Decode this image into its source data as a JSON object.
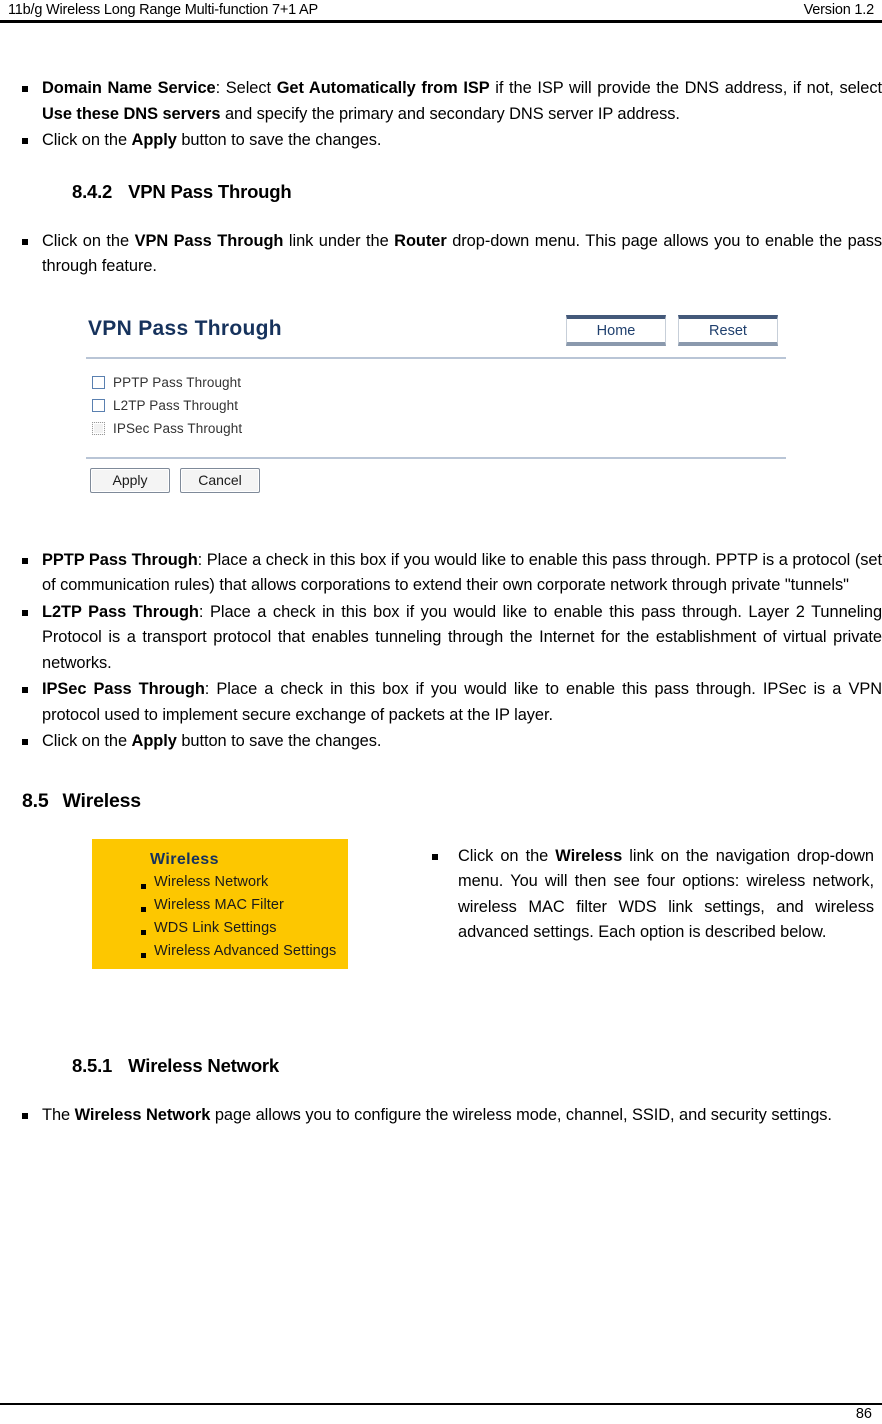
{
  "header": {
    "left": "11b/g Wireless Long Range Multi-function 7+1 AP",
    "right": "Version 1.2"
  },
  "footer": {
    "page_number": "86"
  },
  "intro_bullets": [
    {
      "parts": [
        {
          "text": "Domain Name Service",
          "bold": true
        },
        {
          "text": ": Select ",
          "bold": false
        },
        {
          "text": "Get Automatically from ISP",
          "bold": true
        },
        {
          "text": " if the ISP will provide the DNS address, if not, select ",
          "bold": false
        },
        {
          "text": "Use these DNS servers",
          "bold": true
        },
        {
          "text": " and specify the primary and secondary DNS server IP address.",
          "bold": false
        }
      ]
    },
    {
      "parts": [
        {
          "text": "Click on the ",
          "bold": false
        },
        {
          "text": "Apply",
          "bold": true
        },
        {
          "text": " button to save the changes.",
          "bold": false
        }
      ]
    }
  ],
  "section_842": {
    "number": "8.4.2",
    "title": "VPN Pass Through",
    "bullets": [
      {
        "parts": [
          {
            "text": "Click on the ",
            "bold": false
          },
          {
            "text": "VPN Pass Through",
            "bold": true
          },
          {
            "text": " link under the ",
            "bold": false
          },
          {
            "text": "Router",
            "bold": true
          },
          {
            "text": " drop-down menu. This page allows you to enable the pass through feature.",
            "bold": false
          }
        ]
      }
    ]
  },
  "figure_vpn": {
    "title": "VPN Pass Through",
    "nav_buttons": [
      {
        "label": "Home"
      },
      {
        "label": "Reset"
      }
    ],
    "checkboxes": [
      {
        "label": "PPTP Pass Throught",
        "checked": false,
        "disabled": false
      },
      {
        "label": "L2TP Pass Throught",
        "checked": false,
        "disabled": false
      },
      {
        "label": "IPSec Pass Throught",
        "checked": false,
        "disabled": true
      }
    ],
    "form_buttons": [
      {
        "label": "Apply"
      },
      {
        "label": "Cancel"
      }
    ],
    "accent_color": "#16325c",
    "rule_color": "#b9c5d6"
  },
  "vpn_bullets": [
    {
      "parts": [
        {
          "text": "PPTP Pass Through",
          "bold": true
        },
        {
          "text": ": Place a check in this box if you would like to enable this pass through. PPTP is a protocol (set of communication rules) that allows corporations to extend their own corporate network through private \"tunnels\"",
          "bold": false
        }
      ]
    },
    {
      "parts": [
        {
          "text": "L2TP Pass Through",
          "bold": true
        },
        {
          "text": ": Place a check in this box if you would like to enable this pass through. Layer 2 Tunneling Protocol is a transport protocol that enables tunneling through the Internet for the establishment of virtual private networks.",
          "bold": false
        }
      ]
    },
    {
      "parts": [
        {
          "text": "IPSec Pass Through",
          "bold": true
        },
        {
          "text": ": Place a check in this box if you would like to enable this pass through. IPSec is a VPN protocol used to implement secure exchange of packets at the IP layer.",
          "bold": false
        }
      ]
    },
    {
      "parts": [
        {
          "text": "Click on the ",
          "bold": false
        },
        {
          "text": "Apply",
          "bold": true
        },
        {
          "text": " button to save the changes.",
          "bold": false
        }
      ]
    }
  ],
  "section_85": {
    "number": "8.5",
    "title": "Wireless"
  },
  "figure_wireless": {
    "title": "Wireless",
    "background_color": "#fdc700",
    "title_color": "#16325c",
    "items": [
      {
        "label": "Wireless Network"
      },
      {
        "label": "Wireless MAC Filter"
      },
      {
        "label": "WDS Link Settings"
      },
      {
        "label": "Wireless Advanced Settings"
      }
    ]
  },
  "wireless_bullets": [
    {
      "parts": [
        {
          "text": "Click on the ",
          "bold": false
        },
        {
          "text": "Wireless",
          "bold": true
        },
        {
          "text": " link on the navigation drop-down menu. You will then see four options: wireless network, wireless MAC filter WDS link settings, and wireless advanced settings. Each option is described below.",
          "bold": false
        }
      ]
    }
  ],
  "section_851": {
    "number": "8.5.1",
    "title": "Wireless Network",
    "bullets": [
      {
        "parts": [
          {
            "text": "The ",
            "bold": false
          },
          {
            "text": "Wireless Network",
            "bold": true
          },
          {
            "text": " page allows you to configure the wireless mode, channel, SSID, and security settings.",
            "bold": false
          }
        ]
      }
    ]
  }
}
